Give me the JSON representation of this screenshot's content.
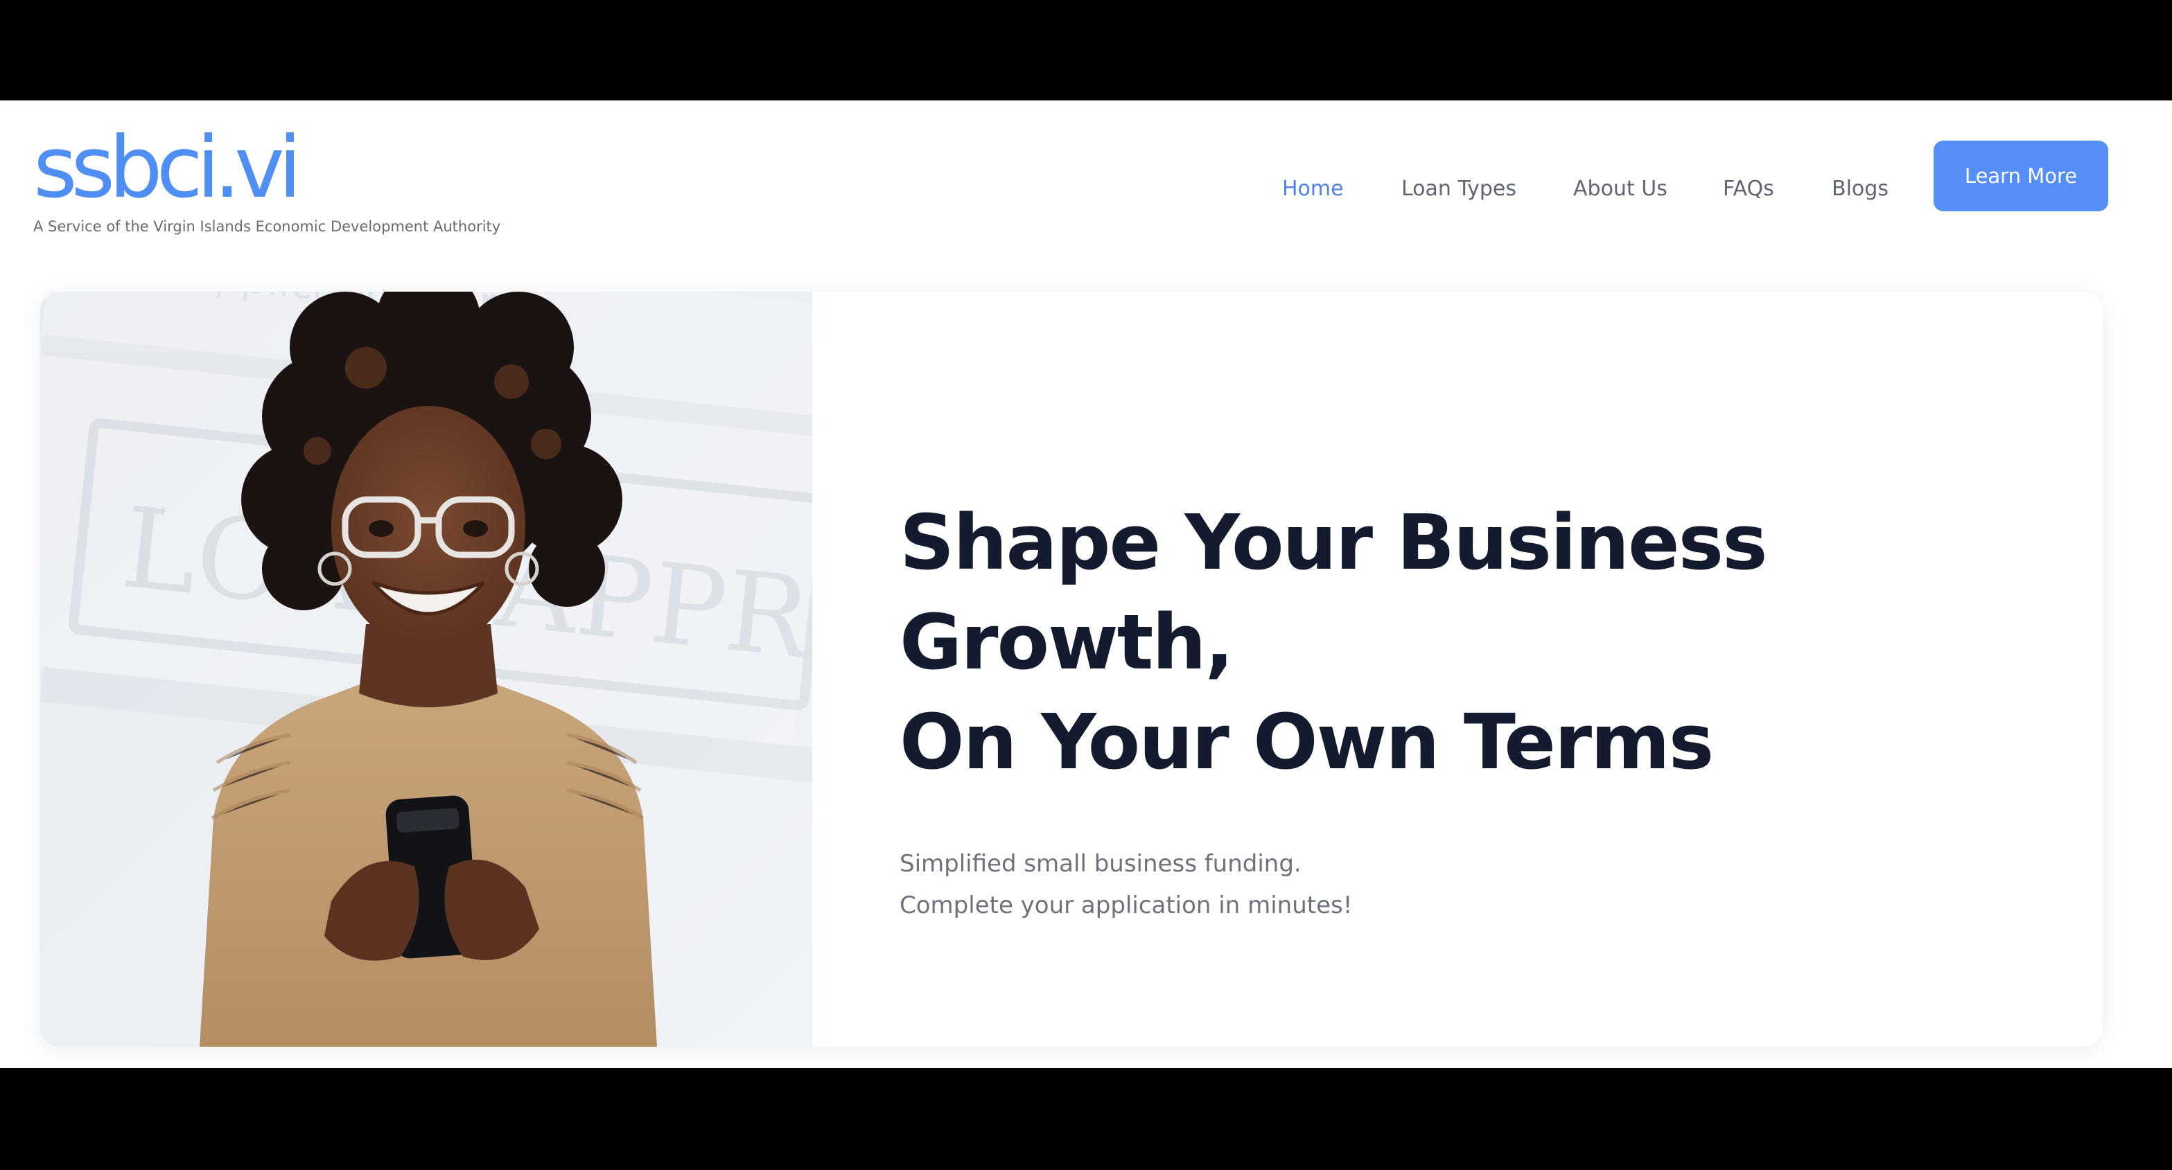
{
  "header": {
    "logo_text": "ssbci.vi",
    "tagline": "A Service of the Virgin Islands Economic Development Authority",
    "nav": [
      {
        "label": "Home",
        "active": true
      },
      {
        "label": "Loan Types",
        "active": false
      },
      {
        "label": "About Us",
        "active": false
      },
      {
        "label": "FAQs",
        "active": false
      },
      {
        "label": "Blogs",
        "active": false
      }
    ],
    "cta_label": "Learn More"
  },
  "hero": {
    "title_line1": "Shape Your Business Growth,",
    "title_line2": "On Your Own Terms",
    "subtitle_line1": "Simplified small business funding.",
    "subtitle_line2": "Complete your application in minutes!",
    "background_sign_text": [
      "LOAN APPROV",
      "Application Form"
    ]
  },
  "colors": {
    "brand_blue": "#4f8ef5",
    "active_nav": "#4f83e8",
    "button_blue": "#558ef7",
    "heading": "#141b2e",
    "body_text": "#6e727b"
  }
}
